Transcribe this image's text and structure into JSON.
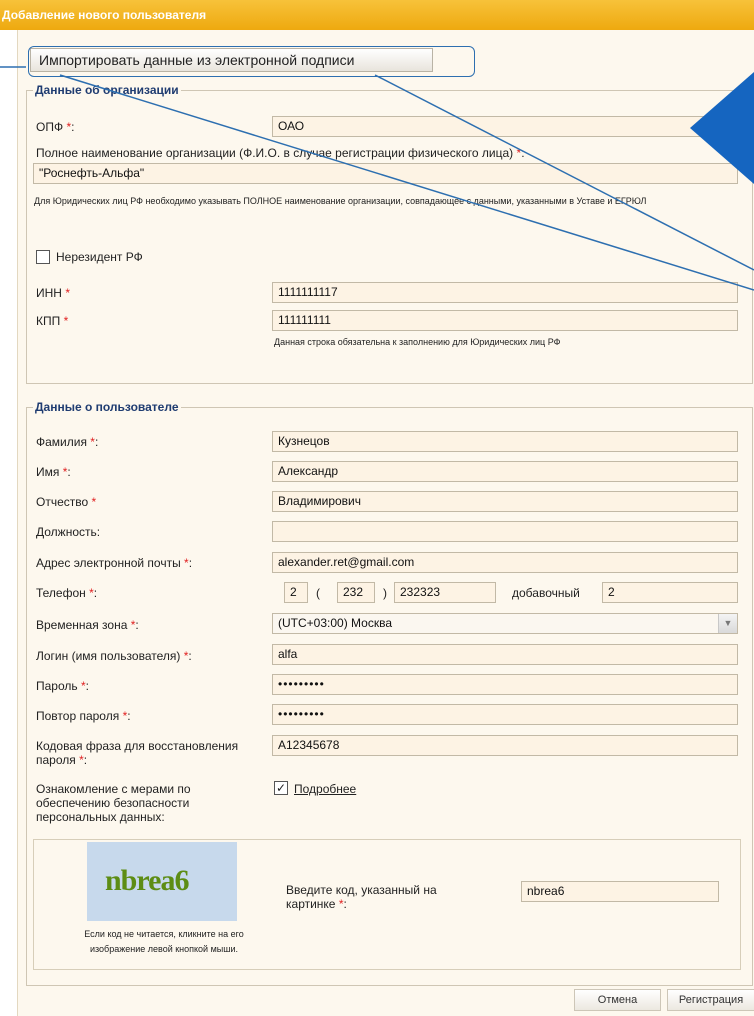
{
  "window": {
    "title": "Добавление нового пользователя"
  },
  "import_button": "Импортировать данные из электронной подписи",
  "org": {
    "legend": "Данные об организации",
    "opf_label": "ОПФ",
    "opf_value": "ОАО",
    "fullname_label": "Полное наименование организации (Ф.И.О. в случае регистрации физического лица)",
    "fullname_value": "\"Роснефть-Альфа\"",
    "fullname_note": "Для Юридических лиц РФ необходимо указывать ПОЛНОЕ наименование организации, совпадающее с данными, указанными в Уставе и ЕГРЮЛ",
    "nonresident_label": "Нерезидент РФ",
    "inn_label": "ИНН",
    "inn_value": "1111111117",
    "kpp_label": "КПП",
    "kpp_value": "111111111",
    "kpp_note": "Данная строка обязательна к заполнению для Юридических лиц РФ"
  },
  "user": {
    "legend": "Данные о пользователе",
    "lastname_label": "Фамилия",
    "lastname_value": "Кузнецов",
    "firstname_label": "Имя",
    "firstname_value": "Александр",
    "middlename_label": "Отчество",
    "middlename_value": "Владимирович",
    "position_label": "Должность:",
    "position_value": "",
    "email_label": "Адрес электронной почты",
    "email_value": "alexander.ret@gmail.com",
    "phone_label": "Телефон",
    "phone_country": "2",
    "phone_code": "232",
    "phone_number": "232323",
    "phone_ext_label": "добавочный",
    "phone_ext": "2",
    "tz_label": "Временная зона",
    "tz_value": "(UTC+03:00) Москва",
    "login_label": "Логин (имя пользователя)",
    "login_value": "alfa",
    "password_label": "Пароль",
    "password_value": "•••••••••",
    "password_repeat_label": "Повтор пароля",
    "password_repeat_value": "•••••••••",
    "codephrase_label_1": "Кодовая фраза для восстановления",
    "codephrase_label_2": "пароля",
    "codephrase_value": "A12345678",
    "security_label_1": "Ознакомление с мерами по",
    "security_label_2": "обеспечению безопасности",
    "security_label_3": "персональных данных:",
    "security_link": "Подробнее",
    "captcha_text": "nbrea6",
    "captcha_note_1": "Если код не читается, кликните на его",
    "captcha_note_2": "изображение левой кнопкой мыши.",
    "captcha_prompt_1": "Введите код, указанный на",
    "captcha_prompt_2": "картинке",
    "captcha_value": "nbrea6"
  },
  "buttons": {
    "cancel": "Отмена",
    "register": "Регистрация"
  },
  "required_mark": "*",
  "colors": {
    "titlebar": "#f2b322",
    "legend": "#1f3c71",
    "required": "#e02020",
    "input_bg": "#fdf3e4",
    "arrow": "#1565c0",
    "callout": "#2d6fb0"
  }
}
